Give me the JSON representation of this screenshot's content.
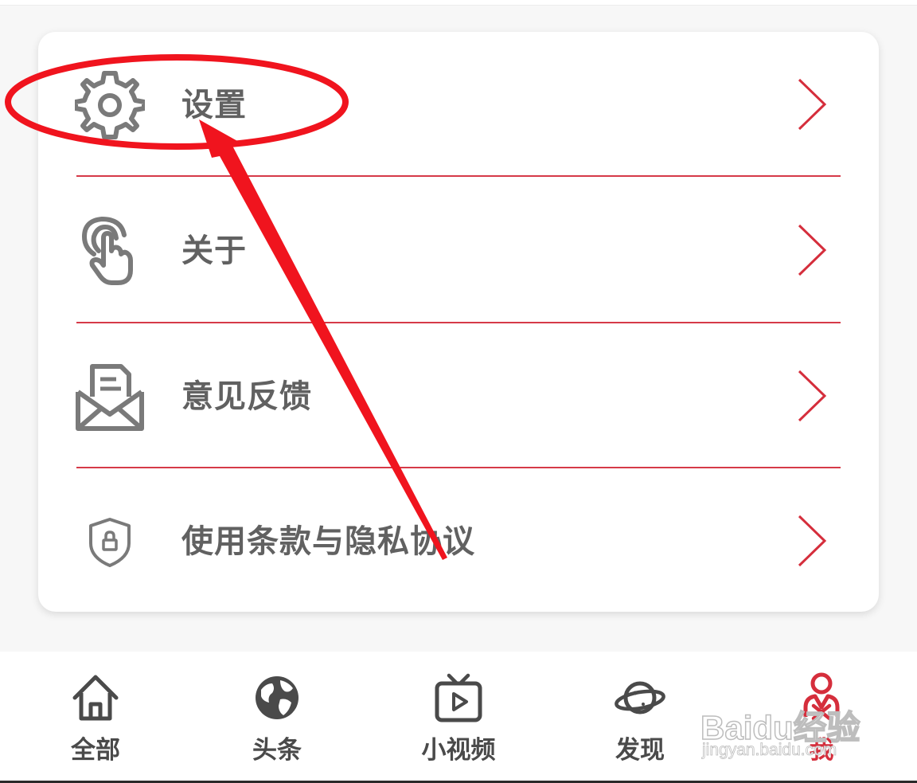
{
  "menu": {
    "items": [
      {
        "label": "设置",
        "icon": "gear-icon"
      },
      {
        "label": "关于",
        "icon": "touch-hand-icon"
      },
      {
        "label": "意见反馈",
        "icon": "envelope-letter-icon"
      },
      {
        "label": "使用条款与隐私协议",
        "icon": "shield-lock-icon"
      }
    ]
  },
  "tabbar": {
    "tabs": [
      {
        "label": "全部",
        "icon": "home-icon"
      },
      {
        "label": "头条",
        "icon": "globe-icon"
      },
      {
        "label": "小视频",
        "icon": "tv-play-icon"
      },
      {
        "label": "发现",
        "icon": "planet-icon"
      },
      {
        "label": "我",
        "icon": "person-icon",
        "active": true
      }
    ]
  },
  "watermark": {
    "main": "Baidu经验",
    "sub": "jingyan.baidu.com"
  },
  "colors": {
    "accent": "#d52e3c",
    "divider": "#d63a48",
    "text": "#616161",
    "icon": "#7a7a7a",
    "annotation": "#f0141e"
  }
}
